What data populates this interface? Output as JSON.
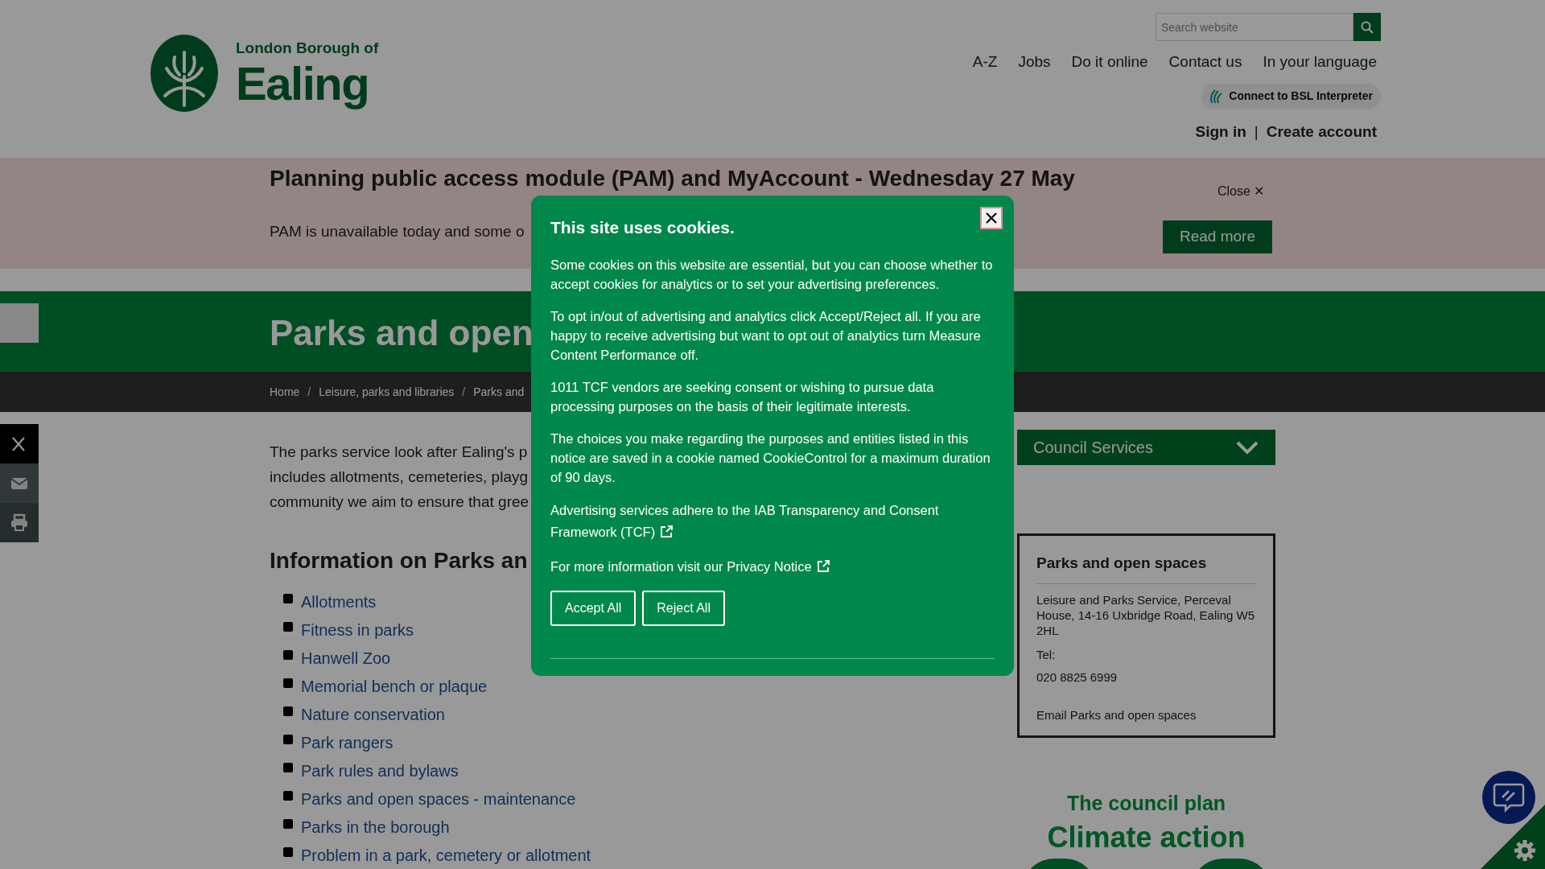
{
  "header": {
    "logo": {
      "line_1": "London Borough of",
      "line_2": "Ealing"
    },
    "search": {
      "placeholder": "Search website"
    },
    "nav": [
      "A-Z",
      "Jobs",
      "Do it online",
      "Contact us",
      "In your language"
    ],
    "bsl_button": "Connect to BSL Interpreter",
    "account_links": [
      "Sign in",
      "|",
      "Create account"
    ]
  },
  "alert_banner": {
    "title": "Planning public access module (PAM) and MyAccount - Wednesday 27 May",
    "text": "PAM is unavailable today and some o",
    "close": "Close",
    "close_icon": "✕",
    "button": "Read more"
  },
  "page_title": "Parks and open",
  "breadcrumb": [
    {
      "label": "Home"
    },
    {
      "separator": "/",
      "label": "Leisure, parks and libraries"
    },
    {
      "separator": "/",
      "label": "Parks and"
    }
  ],
  "share_buttons": [
    {
      "kind": "x"
    },
    {
      "kind": "email"
    },
    {
      "kind": "print"
    }
  ],
  "intro_lines": [
    "The parks service look after Ealing's p",
    "includes allotments, cemeteries, playg",
    "community we aim to ensure that gree"
  ],
  "section_heading": "Information on Parks an",
  "links": [
    "Allotments",
    "Fitness in parks",
    "Hanwell Zoo",
    "Memorial bench or plaque",
    "Nature conservation",
    "Park rangers",
    "Park rules and bylaws",
    "Parks and open spaces - maintenance",
    "Parks in the borough",
    "Problem in a park, cemetery or allotment"
  ],
  "sidebar": {
    "dropdown": {
      "label": "Council Services",
      "expanded": false
    },
    "contact_card": {
      "title": "Parks and open spaces",
      "address": "Leisure and Parks Service, Perceval House, 14-16 Uxbridge Road, Ealing W5 2HL",
      "tel_label": "Tel:",
      "tel": "020 8825 6999",
      "email": "Email Parks and open spaces"
    },
    "promo": {
      "line_1": "The council plan",
      "line_2": "Climate action"
    }
  },
  "cookie_dialog": {
    "title": "This site uses cookies.",
    "paragraphs": [
      {
        "text": "Some cookies on this website are essential, but you can choose whether to accept cookies for analytics or to set your advertising preferences."
      },
      {
        "text": "To opt in/out of advertising and analytics click Accept/Reject all. If you are happy to receive advertising but want to opt out of analytics turn Measure Content Performance off."
      },
      {
        "text": "1011 TCF vendors are seeking consent or wishing to pursue data processing purposes on the basis of their legitimate interests."
      },
      {
        "text": "The choices you make regarding the purposes and entities listed in this notice are saved in a cookie named CookieControl for a maximum duration of 90 days."
      },
      {
        "text": "Advertising services adhere to the IAB Transparency and Consent Framework (TCF)",
        "kind": "link"
      },
      {
        "text": "For more information visit our Privacy Notice",
        "kind": "link"
      }
    ],
    "buttons": [
      "Accept All",
      "Reject All"
    ]
  }
}
